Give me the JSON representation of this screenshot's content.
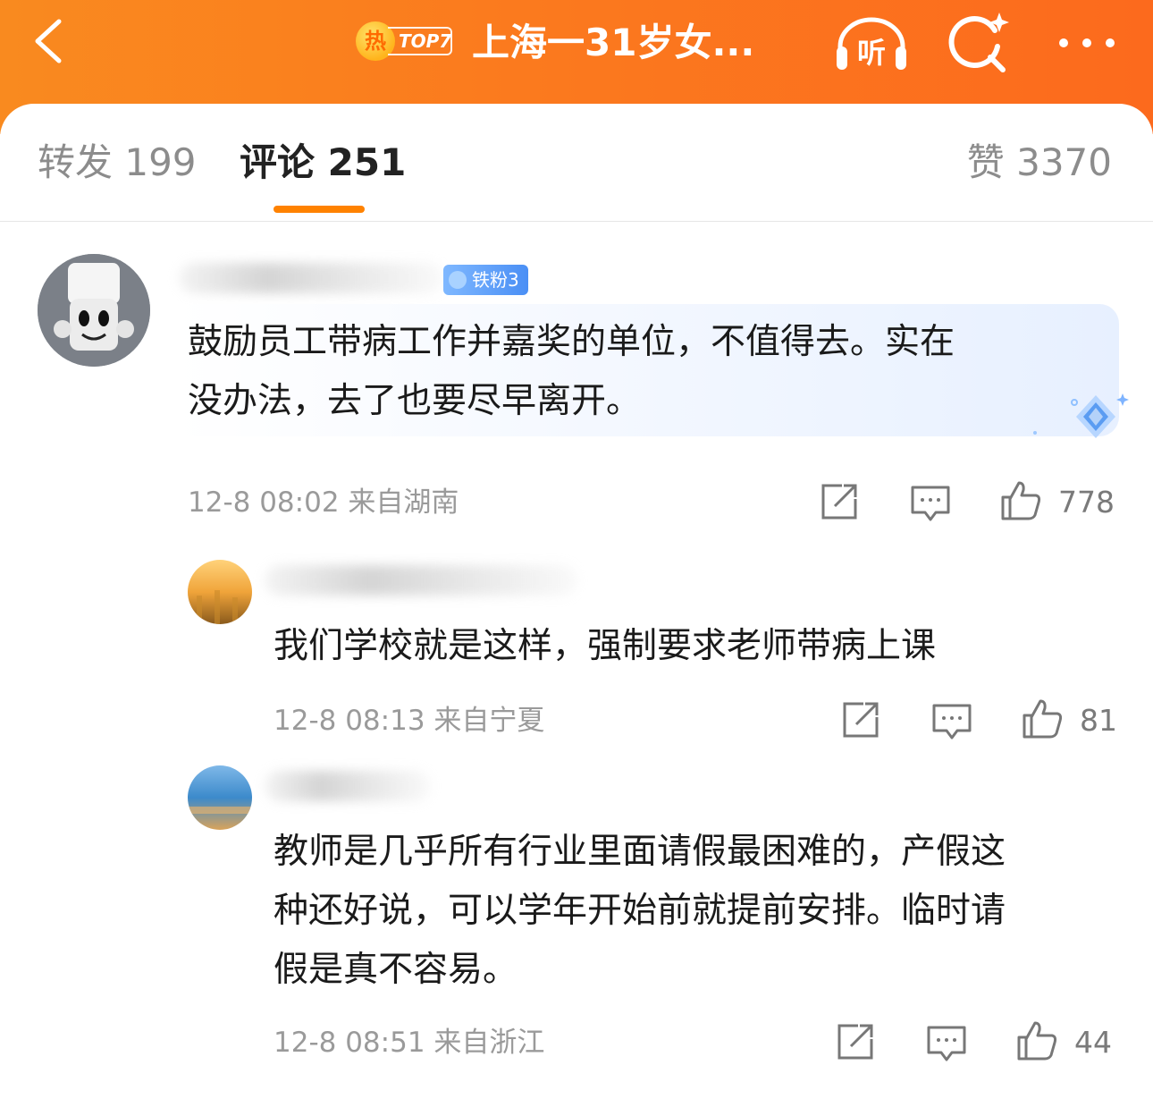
{
  "header": {
    "back_icon": "chevron-left-icon",
    "hot_badge_char": "热",
    "hot_badge_rank": "TOP7",
    "title": "上海一31岁女...",
    "listen_label": "听",
    "listen_icon": "headphones-icon",
    "search_icon": "search-icon",
    "more_icon": "more-dots-icon",
    "background": "#fb7a1e"
  },
  "tabs": {
    "repost": "转发 199",
    "comments": "评论 251",
    "likes": "赞 3370",
    "active": "comments",
    "indicator_color": "#ff8200"
  },
  "comments": [
    {
      "fan_badge": "铁粉3",
      "text_lines": [
        "鼓励员工带病工作并嘉奖的单位，不值得去。实在",
        "没办法，去了也要尽早离开。"
      ],
      "meta": "12-8 08:02  来自湖南",
      "likes": "778"
    },
    {
      "text_lines": [
        "我们学校就是这样，强制要求老师带病上课"
      ],
      "meta": "12-8 08:13  来自宁夏",
      "likes": "81"
    },
    {
      "text_lines": [
        "教师是几乎所有行业里面请假最困难的，产假这",
        "种还好说，可以学年开始前就提前安排。临时请",
        "假是真不容易。"
      ],
      "meta": "12-8 08:51  来自浙江",
      "likes": "44"
    }
  ]
}
